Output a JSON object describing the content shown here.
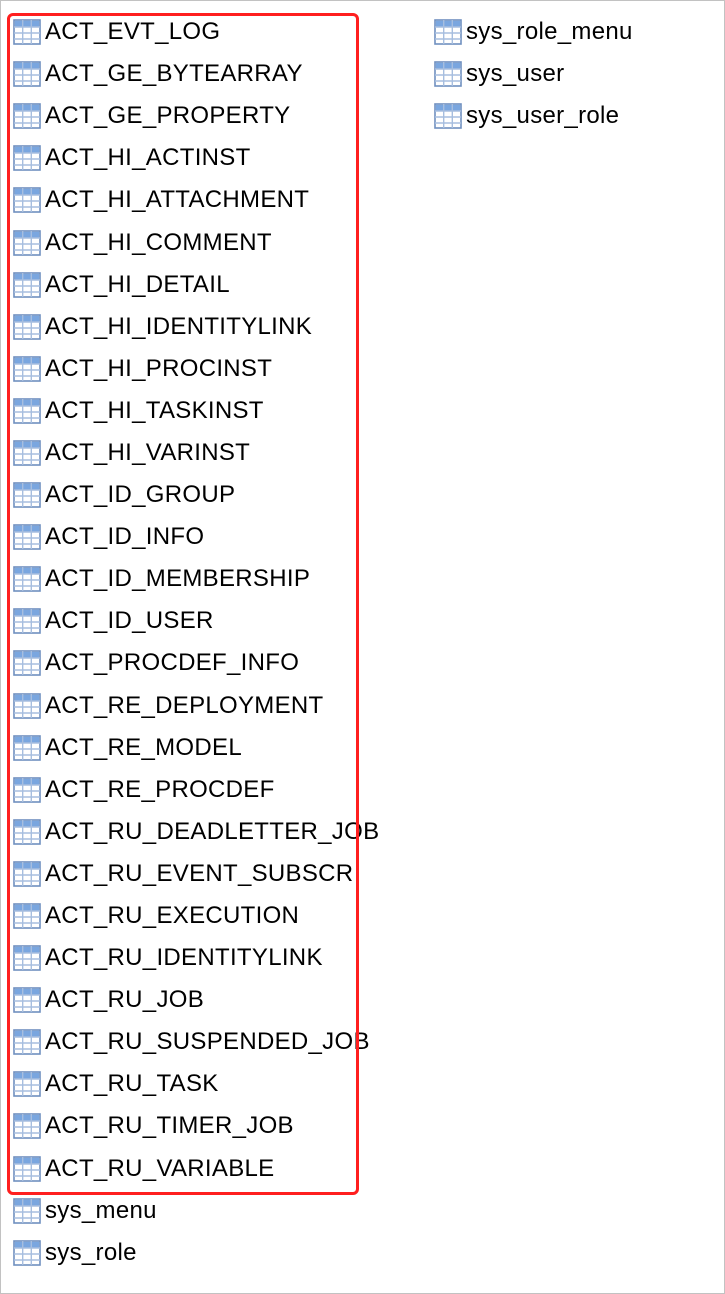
{
  "columns": {
    "col1": [
      "ACT_EVT_LOG",
      "ACT_GE_BYTEARRAY",
      "ACT_GE_PROPERTY",
      "ACT_HI_ACTINST",
      "ACT_HI_ATTACHMENT",
      "ACT_HI_COMMENT",
      "ACT_HI_DETAIL",
      "ACT_HI_IDENTITYLINK",
      "ACT_HI_PROCINST",
      "ACT_HI_TASKINST",
      "ACT_HI_VARINST",
      "ACT_ID_GROUP",
      "ACT_ID_INFO",
      "ACT_ID_MEMBERSHIP",
      "ACT_ID_USER",
      "ACT_PROCDEF_INFO",
      "ACT_RE_DEPLOYMENT",
      "ACT_RE_MODEL",
      "ACT_RE_PROCDEF",
      "ACT_RU_DEADLETTER_JOB",
      "ACT_RU_EVENT_SUBSCR",
      "ACT_RU_EXECUTION",
      "ACT_RU_IDENTITYLINK",
      "ACT_RU_JOB",
      "ACT_RU_SUSPENDED_JOB",
      "ACT_RU_TASK",
      "ACT_RU_TIMER_JOB",
      "ACT_RU_VARIABLE",
      "sys_menu",
      "sys_role"
    ],
    "col2": [
      "sys_role_menu",
      "sys_user",
      "sys_user_role"
    ]
  }
}
